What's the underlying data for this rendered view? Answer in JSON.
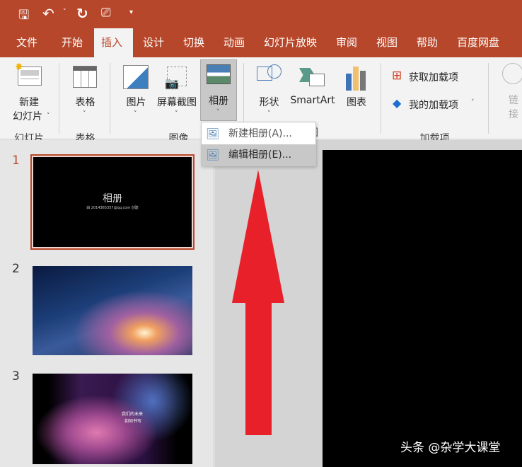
{
  "qat": {
    "icons": [
      "save-icon",
      "undo-icon",
      "redo-icon",
      "present-icon",
      "customize-icon"
    ]
  },
  "tabs": [
    "文件",
    "开始",
    "插入",
    "设计",
    "切换",
    "动画",
    "幻灯片放映",
    "审阅",
    "视图",
    "帮助",
    "百度网盘"
  ],
  "ribbon": {
    "new_slide": [
      "新建",
      "幻灯片"
    ],
    "table": "表格",
    "picture": "图片",
    "screenshot": "屏幕截图",
    "album": "相册",
    "shapes": "形状",
    "smartart": "SmartArt",
    "chart": "图表",
    "get_addins": "获取加载项",
    "my_addins": "我的加载项",
    "link": [
      "链",
      "接"
    ],
    "groups": {
      "slides": "幻灯片",
      "tables": "表格",
      "images": "图像",
      "illustrations_tail": "图",
      "addins": "加载项"
    }
  },
  "menu": {
    "items": [
      "新建相册(A)...",
      "编辑相册(E)..."
    ]
  },
  "slides": [
    {
      "num": "1",
      "title": "相册",
      "subtitle": "由 2014365357@qq.com 创建"
    },
    {
      "num": "2"
    },
    {
      "num": "3",
      "caption": [
        "我们的未来",
        "如何书写"
      ]
    }
  ],
  "watermark": "头条 @杂学大课堂",
  "colors": {
    "accent": "#b7472a",
    "arrow": "#e8202a"
  }
}
